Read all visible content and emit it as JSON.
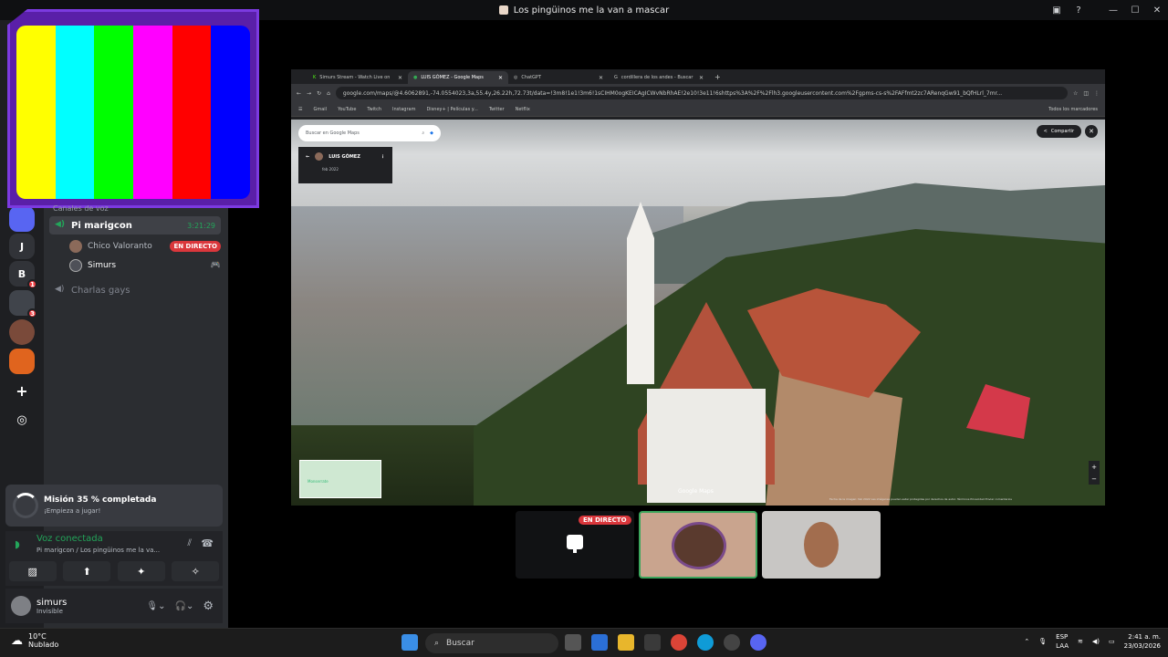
{
  "window": {
    "title": "Los pingüinos me la van a mascar"
  },
  "servers": [
    {
      "label": "J",
      "badge": ""
    },
    {
      "label": "B",
      "badge": "1"
    },
    {
      "label": "",
      "badge": "3"
    }
  ],
  "sidebar": {
    "voice_section": "Canales de voz",
    "channels": [
      {
        "name": "Pi marigcon",
        "time": "3:21:29"
      },
      {
        "name": "Charlas gays"
      }
    ],
    "users": [
      {
        "name": "Chico Valoranto",
        "live": "EN DIRECTO"
      },
      {
        "name": "Simurs"
      }
    ]
  },
  "mission": {
    "title": "Misión 35 % completada",
    "subtitle": "¡Empieza a jugar!"
  },
  "voice": {
    "status": "Voz conectada",
    "channel": "Pi marigcon",
    "server": "Los pingüinos me la va..."
  },
  "user": {
    "name": "simurs",
    "status": "Invisible"
  },
  "browser": {
    "tabs": [
      {
        "title": "Simurs Stream - Watch Live on"
      },
      {
        "title": "LUIS GÓMEZ - Google Maps"
      },
      {
        "title": "ChatGPT"
      },
      {
        "title": "cordillera de los andes - Buscar"
      }
    ],
    "url": "google.com/maps/@4.6062891,-74.0554023,3a,55.4y,26.22h,72.73t/data=!3m8!1e1!3m6!1sCIHM0ogKEICAgICWvNbRhAE!2e10!3e11!6shttps%3A%2F%2Flh3.googleusercontent.com%2Fgpms-cs-s%2FAFfmt2zc7ARenqGw91_bQfHLrl_7mr...",
    "bookmarks": [
      "Gmail",
      "YouTube",
      "Twitch",
      "Instagram",
      "Disney+ | Películas y...",
      "Twitter",
      "Netflix"
    ],
    "all_bookmarks": "Todos los marcadores"
  },
  "maps": {
    "search_placeholder": "Buscar en Google Maps",
    "author": "LUIS GÓMEZ",
    "date": "feb 2022",
    "share": "Compartir",
    "minimap_label": "Monserrate",
    "logo": "Google Maps",
    "footer": "Fecha de la imagen: feb 2022   Las imágenes pueden estar protegidas por derechos de autor.   Términos   Privacidad   Enviar comentarios"
  },
  "call": {
    "live": "EN DIRECTO"
  },
  "taskbar": {
    "temp": "10°C",
    "weather": "Nublado",
    "search": "Buscar",
    "lang1": "ESP",
    "lang2": "LAA",
    "time": "2:41 a. m.",
    "date": "23/03/2026"
  },
  "colors": {
    "bars": [
      "#ffff00",
      "#00ffff",
      "#00ff00",
      "#ff00ff",
      "#ff0000",
      "#0000ff"
    ]
  }
}
